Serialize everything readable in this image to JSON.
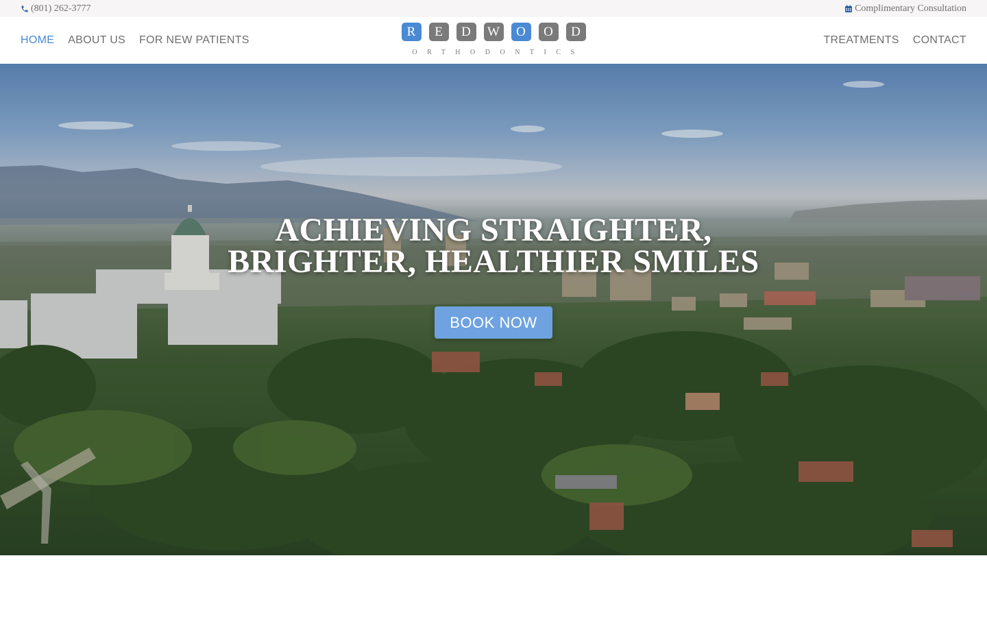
{
  "topbar": {
    "phone": "(801) 262-3777",
    "consultation": "Complimentary Consultation",
    "accent_color": "#4a8ad4"
  },
  "nav": {
    "left": [
      {
        "label": "HOME",
        "active": true
      },
      {
        "label": "ABOUT US",
        "active": false
      },
      {
        "label": "FOR NEW PATIENTS",
        "active": false
      }
    ],
    "right": [
      {
        "label": "TREATMENTS",
        "active": false
      },
      {
        "label": "CONTACT",
        "active": false
      }
    ]
  },
  "logo": {
    "letters": [
      "R",
      "E",
      "D",
      "W",
      "O",
      "O",
      "D"
    ],
    "subtitle": "ORTHODONTICS",
    "tile_color": "#7a7a7a",
    "highlight_color": "#4a8ad4"
  },
  "hero": {
    "title_line1": "ACHIEVING STRAIGHTER,",
    "title_line2": "BRIGHTER, HEALTHIER SMILES",
    "cta_label": "BOOK NOW",
    "cta_color": "#6fa2e0"
  },
  "icons": {
    "phone": "phone-icon",
    "calendar": "calendar-icon"
  }
}
